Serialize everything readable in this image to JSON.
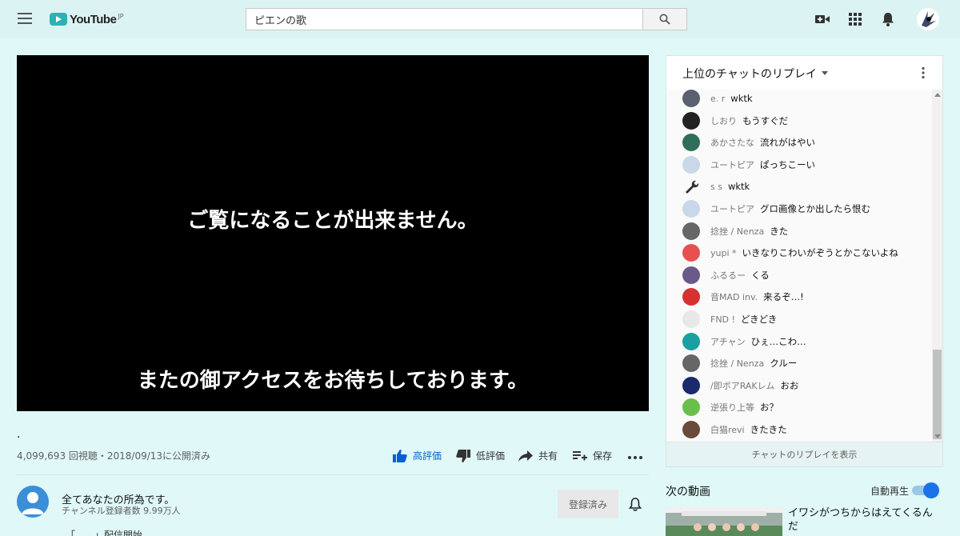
{
  "header": {
    "logo_text": "YouTube",
    "logo_region": "JP",
    "search_value": "ピエンの歌"
  },
  "player": {
    "line1": "ご覧になることが出来ません。",
    "line2": "またの御アクセスをお待ちしております。"
  },
  "video": {
    "title": ".",
    "meta": "4,099,693 回視聴・2018/09/13に公開済み",
    "actions": {
      "like": "高評価",
      "dislike": "低評価",
      "share": "共有",
      "save": "保存"
    }
  },
  "channel": {
    "name": "全てあなたの所為です。",
    "subscribers": "チャンネル登録者数 9.99万人",
    "subscribe_label": "登録済み",
    "description_partial": "「　　」配信開始"
  },
  "chat": {
    "title": "上位のチャットのリプレイ",
    "messages": [
      {
        "author": "e. r",
        "text": "wktk",
        "avatar": "#5a6070"
      },
      {
        "author": "しおり",
        "text": "もうすぐだ",
        "avatar": "#222222"
      },
      {
        "author": "あかさたな",
        "text": "流れがはやい",
        "avatar": "#2f6f5a"
      },
      {
        "author": "ユートピア",
        "text": "ぱっちこーい",
        "avatar": "#c8d8e8"
      },
      {
        "author": "s s",
        "text": "wktk",
        "avatar": "wrench"
      },
      {
        "author": "ユートピア",
        "text": "グロ画像とか出したら恨む",
        "avatar": "#c8d8e8"
      },
      {
        "author": "捻挫 / Nenza",
        "text": "きた",
        "avatar": "#666666"
      },
      {
        "author": "yupi *",
        "text": "いきなりこわいがぞうとかこないよね",
        "avatar": "#e85050"
      },
      {
        "author": "ふるるー",
        "text": "くる",
        "avatar": "#6a5a8a"
      },
      {
        "author": "音MAD inv.",
        "text": "来るぞ…!",
        "avatar": "#d83030"
      },
      {
        "author": "FND !",
        "text": "どきどき",
        "avatar": "#e8e8e8"
      },
      {
        "author": "アチャン",
        "text": "ひぇ…こわ…",
        "avatar": "#1aa0a0"
      },
      {
        "author": "捻挫 / Nenza",
        "text": "クルー",
        "avatar": "#666666"
      },
      {
        "author": "/即ボアRAKレム",
        "text": "おお",
        "avatar": "#1a2a6a"
      },
      {
        "author": "逆張り上等",
        "text": "お？",
        "avatar": "#6abf4a"
      },
      {
        "author": "白猫revi",
        "text": "きたきた",
        "avatar": "#6a4a3a"
      }
    ],
    "footer": "チャットのリプレイを表示"
  },
  "sidebar": {
    "next_title": "次の動画",
    "autoplay_label": "自動再生",
    "autoplay_on": true,
    "next_video_title": "イワシがつちからはえてくるんだ"
  }
}
